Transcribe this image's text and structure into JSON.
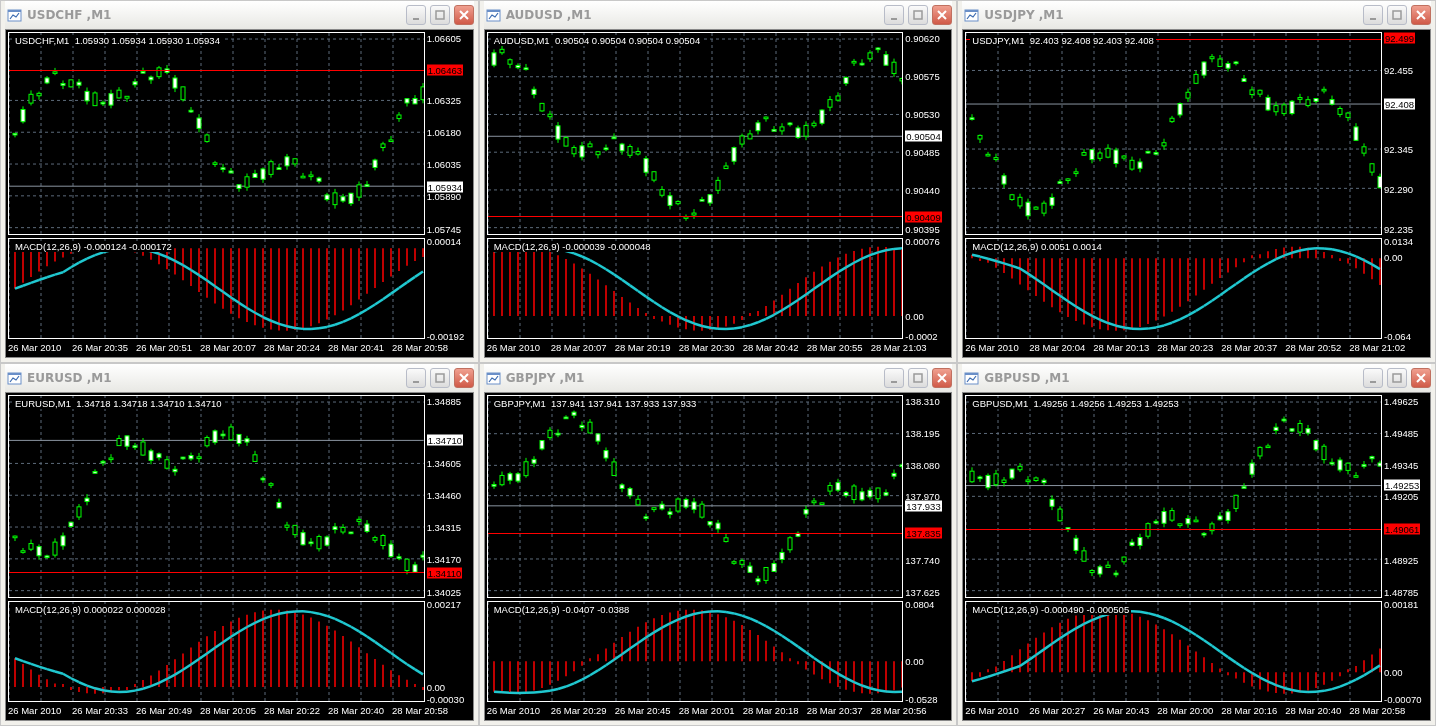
{
  "windows": [
    {
      "title": "USDCHF ,M1",
      "legend": "USDCHF,M1  1.05930 1.05934 1.05930 1.05934",
      "price_ticks": [
        "1.06605",
        "1.06325",
        "1.06180",
        "1.06035",
        "1.05890",
        "1.05745"
      ],
      "bid": "1.05934",
      "line_price": "1.06463",
      "macd_legend": "MACD(12,26,9) -0.000124 -0.000172",
      "macd_ticks": [
        "0.00014",
        "-0.00192"
      ],
      "time_labels": [
        "26 Mar 2010",
        "26 Mar 20:35",
        "26 Mar 20:51",
        "28 Mar 20:07",
        "28 Mar 20:24",
        "28 Mar 20:41",
        "28 Mar 20:58"
      ]
    },
    {
      "title": "AUDUSD ,M1",
      "legend": "AUDUSD,M1  0.90504 0.90504 0.90504 0.90504",
      "price_ticks": [
        "0.90620",
        "0.90575",
        "0.90530",
        "0.90485",
        "0.90440",
        "0.90395"
      ],
      "bid": "0.90504",
      "line_price": "0.90409",
      "macd_legend": "MACD(12,26,9) -0.000039 -0.000048",
      "macd_ticks": [
        "0.00076",
        "0.00",
        "-0.0002"
      ],
      "time_labels": [
        "26 Mar 2010",
        "28 Mar 20:07",
        "28 Mar 20:19",
        "28 Mar 20:30",
        "28 Mar 20:42",
        "28 Mar 20:55",
        "28 Mar 21:03"
      ]
    },
    {
      "title": "USDJPY ,M1",
      "legend": "USDJPY,M1  92.403 92.408 92.403 92.408",
      "price_ticks": [
        "92.455",
        "92.345",
        "92.290",
        "92.235"
      ],
      "bid": "92.408",
      "line_price": "92.499",
      "macd_legend": "MACD(12,26,9) 0.0051 0.0014",
      "macd_ticks": [
        "0.0134",
        "0.00",
        "-0.064"
      ],
      "time_labels": [
        "26 Mar 2010",
        "28 Mar 20:04",
        "28 Mar 20:13",
        "28 Mar 20:23",
        "28 Mar 20:37",
        "28 Mar 20:52",
        "28 Mar 21:02"
      ]
    },
    {
      "title": "EURUSD ,M1",
      "legend": "EURUSD,M1  1.34718 1.34718 1.34710 1.34710",
      "price_ticks": [
        "1.34885",
        "1.34605",
        "1.34460",
        "1.34315",
        "1.34170",
        "1.34025"
      ],
      "bid": "1.34710",
      "line_price": "1.34110",
      "macd_legend": "MACD(12,26,9) 0.000022 0.000028",
      "macd_ticks": [
        "0.00217",
        "0.00",
        "-0.00030"
      ],
      "time_labels": [
        "26 Mar 2010",
        "26 Mar 20:33",
        "26 Mar 20:49",
        "28 Mar 20:05",
        "28 Mar 20:22",
        "28 Mar 20:40",
        "28 Mar 20:58"
      ]
    },
    {
      "title": "GBPJPY ,M1",
      "legend": "GBPJPY,M1  137.941 137.941 137.933 137.933",
      "price_ticks": [
        "138.310",
        "138.195",
        "138.080",
        "137.970",
        "137.740",
        "137.625"
      ],
      "bid": "137.933",
      "line_price": "137.835",
      "macd_legend": "MACD(12,26,9) -0.0407 -0.0388",
      "macd_ticks": [
        "0.0804",
        "0.00",
        "-0.0528"
      ],
      "time_labels": [
        "26 Mar 2010",
        "26 Mar 20:29",
        "26 Mar 20:45",
        "28 Mar 20:01",
        "28 Mar 20:18",
        "28 Mar 20:37",
        "28 Mar 20:56"
      ]
    },
    {
      "title": "GBPUSD ,M1",
      "legend": "GBPUSD,M1  1.49256 1.49256 1.49253 1.49253",
      "price_ticks": [
        "1.49625",
        "1.49485",
        "1.49345",
        "1.49205",
        "1.48925",
        "1.48785"
      ],
      "bid": "1.49253",
      "line_price": "1.49061",
      "macd_legend": "MACD(12,26,9) -0.000490 -0.000505",
      "macd_ticks": [
        "0.00181",
        "0.00",
        "-0.00070"
      ],
      "time_labels": [
        "26 Mar 2010",
        "26 Mar 20:27",
        "26 Mar 20:43",
        "28 Mar 20:00",
        "28 Mar 20:16",
        "28 Mar 20:40",
        "28 Mar 20:58"
      ]
    }
  ]
}
